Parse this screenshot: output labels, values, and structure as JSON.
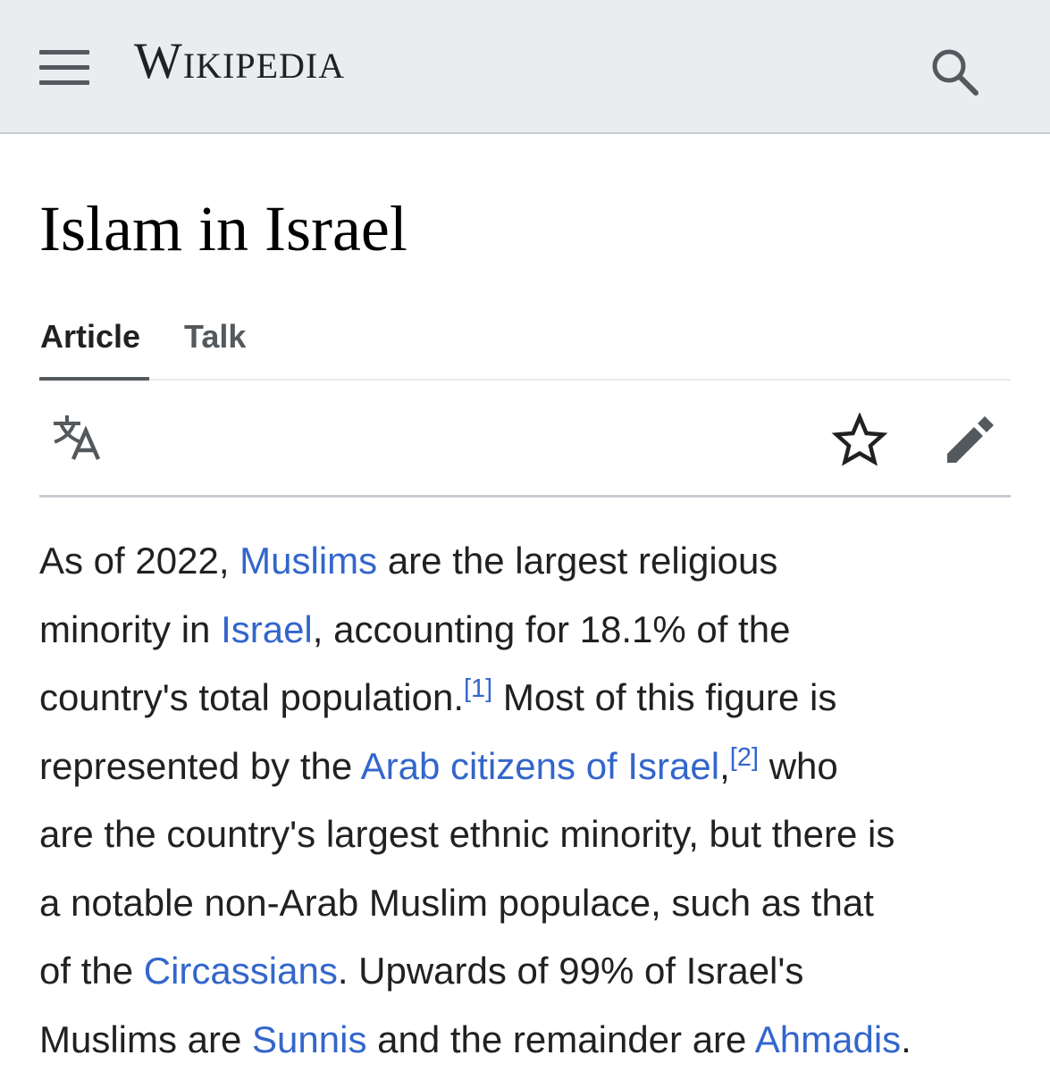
{
  "header": {
    "menu_icon": "hamburger-menu-icon",
    "wordmark": "Wikipedia",
    "search_icon": "search-icon"
  },
  "page": {
    "title": "Islam in Israel"
  },
  "tabs": [
    {
      "label": "Article",
      "active": true
    },
    {
      "label": "Talk",
      "active": false
    }
  ],
  "actions": {
    "language_icon": "language-icon",
    "watch_icon": "star-icon",
    "edit_icon": "pencil-edit-icon"
  },
  "article": {
    "seg1": "As of 2022, ",
    "link_muslims": "Muslims",
    "seg2": " are the largest religious",
    "seg3": "minority in ",
    "link_israel": "Israel",
    "seg4": ", accounting for 18.1% of the",
    "seg5": "country's total population.",
    "ref1": "[1]",
    "seg6": " Most of this figure is",
    "seg7": "represented by the ",
    "link_arab_citizens": "Arab citizens of Israel",
    "seg8": ",",
    "ref2": "[2]",
    "seg9": " who",
    "seg10": "are the country's largest ethnic minority, but there is",
    "seg11": "a notable non-Arab Muslim populace, such as that",
    "seg12": "of the ",
    "link_circassians": "Circassians",
    "seg13": ". Upwards of 99% of Israel's",
    "seg14": "Muslims are ",
    "link_sunnis": "Sunnis",
    "seg15": " and the remainder are ",
    "link_ahmadis": "Ahmadis",
    "seg16": "."
  },
  "colors": {
    "header_bg": "#eaecf0",
    "link": "#3366cc",
    "text": "#202122",
    "icon": "#54595d"
  }
}
